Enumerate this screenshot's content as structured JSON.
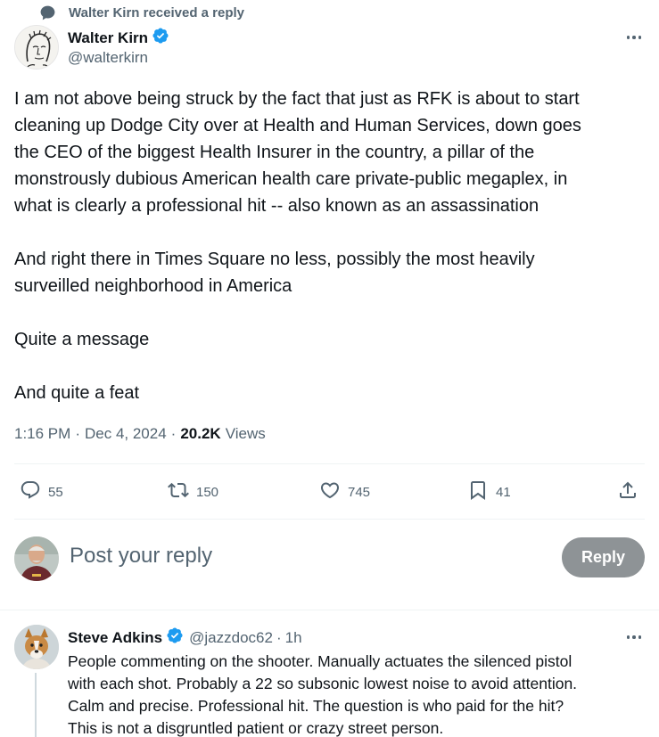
{
  "context": {
    "label": "Walter Kirn received a reply",
    "icon": "chat-bubble-icon"
  },
  "tweet": {
    "author_name": "Walter Kirn",
    "author_handle": "@walterkirn",
    "verified": true,
    "text_lines": [
      "I am not above being struck by the fact that just as  RFK is about to start",
      "cleaning up Dodge City over at Health and Human Services, down goes",
      "the CEO of the biggest Health Insurer in the country, a pillar of the",
      "monstrously dubious American health care private-public megaplex, in",
      "what is clearly a professional hit -- also known as an assassination",
      "",
      "And right there in Times Square no less, possibly the most heavily",
      "surveilled neighborhood in America",
      "",
      "Quite a message",
      "",
      "And quite a feat"
    ],
    "time": "1:16 PM",
    "date": "Dec 4, 2024",
    "views_count": "20.2K",
    "views_label": "Views",
    "separator": "·"
  },
  "actions": {
    "replies": "55",
    "reposts": "150",
    "likes": "745",
    "bookmarks": "41"
  },
  "reply_composer": {
    "placeholder": "Post your reply",
    "button_label": "Reply"
  },
  "reply": {
    "author_name": "Steve Adkins",
    "author_handle": "@jazzdoc62",
    "time_ago": "1h",
    "separator": "·",
    "verified": true,
    "text_lines": [
      "People commenting on the shooter. Manually actuates the silenced pistol",
      "with each shot. Probably a 22 so subsonic lowest noise to avoid attention.",
      "Calm and precise. Professional hit. The question is who paid for the hit?",
      "This is not a disgruntled patient or crazy street person."
    ]
  },
  "colors": {
    "text_primary": "#0f1419",
    "text_secondary": "#536471",
    "verified_blue": "#1d9bf0",
    "divider": "#eff3f4",
    "reply_button_disabled": "#8e9396"
  }
}
